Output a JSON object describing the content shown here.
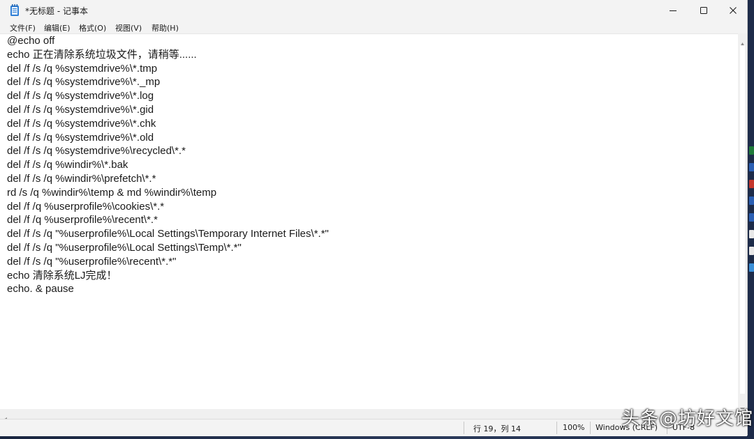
{
  "window": {
    "title": "*无标题 - 记事本"
  },
  "menu": {
    "items": [
      "文件(F)",
      "编辑(E)",
      "格式(O)",
      "视图(V)",
      "帮助(H)"
    ]
  },
  "editor": {
    "lines": [
      "@echo off",
      "echo 正在清除系统垃圾文件，请稍等......",
      "del /f /s /q %systemdrive%\\*.tmp",
      "del /f /s /q %systemdrive%\\*._mp",
      "del /f /s /q %systemdrive%\\*.log",
      "del /f /s /q %systemdrive%\\*.gid",
      "del /f /s /q %systemdrive%\\*.chk",
      "del /f /s /q %systemdrive%\\*.old",
      "del /f /s /q %systemdrive%\\recycled\\*.*",
      "del /f /s /q %windir%\\*.bak",
      "del /f /s /q %windir%\\prefetch\\*.*",
      "rd /s /q %windir%\\temp & md %windir%\\temp",
      "del /f /q %userprofile%\\cookies\\*.*",
      "del /f /q %userprofile%\\recent\\*.*",
      "del /f /s /q \"%userprofile%\\Local Settings\\Temporary Internet Files\\*.*\"",
      "del /f /s /q \"%userprofile%\\Local Settings\\Temp\\*.*\"",
      "del /f /s /q \"%userprofile%\\recent\\*.*\"",
      "echo 清除系统LJ完成！",
      "echo. & pause"
    ]
  },
  "status": {
    "position": "行 19，列 14",
    "zoom": "100%",
    "line_ending": "Windows (CRLF)",
    "encoding": "UTF-8"
  },
  "watermark": "头条@坊好文馆",
  "icons": {
    "app": "notepad-icon",
    "minimize": "minimize-icon",
    "maximize": "maximize-icon",
    "close": "close-icon"
  },
  "colors": {
    "titlebar_bg": "#f3f3f3",
    "editor_bg": "#ffffff",
    "text": "#1a1a1a",
    "desktop": "#1d2b49"
  }
}
